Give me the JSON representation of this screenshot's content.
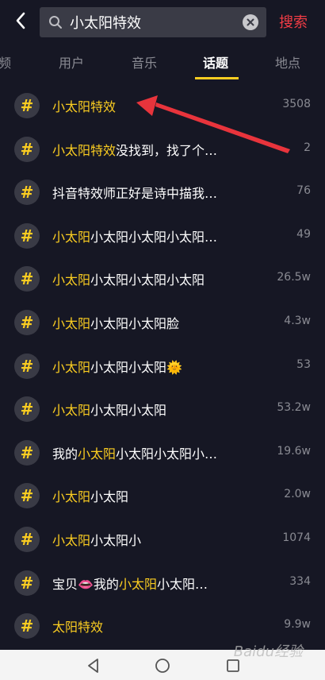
{
  "search": {
    "query": "小太阳特效",
    "submit_label": "搜索"
  },
  "tabs": [
    {
      "label": "频"
    },
    {
      "label": "用户"
    },
    {
      "label": "音乐"
    },
    {
      "label": "话题"
    },
    {
      "label": "地点"
    }
  ],
  "active_tab": "话题",
  "hash_symbol": "#",
  "topics": [
    {
      "segments": [
        {
          "text": "小太阳特效",
          "hl": true
        }
      ],
      "count": "3508"
    },
    {
      "segments": [
        {
          "text": "小太阳特效",
          "hl": true
        },
        {
          "text": "没找到，找了个…",
          "hl": false
        }
      ],
      "count": "2"
    },
    {
      "segments": [
        {
          "text": "抖音特效师正好是诗中描我…",
          "hl": false
        }
      ],
      "count": "76"
    },
    {
      "segments": [
        {
          "text": "小太阳",
          "hl": true
        },
        {
          "text": "小太阳小太阳小太阳…",
          "hl": false
        }
      ],
      "count": "49"
    },
    {
      "segments": [
        {
          "text": "小太阳",
          "hl": true
        },
        {
          "text": "小太阳小太阳小太阳",
          "hl": false
        }
      ],
      "count": "26.5w"
    },
    {
      "segments": [
        {
          "text": "小太阳",
          "hl": true
        },
        {
          "text": "小太阳小太阳脸",
          "hl": false
        }
      ],
      "count": "4.3w"
    },
    {
      "segments": [
        {
          "text": "小太阳",
          "hl": true
        },
        {
          "text": "小太阳小太阳🌞",
          "hl": false
        }
      ],
      "count": "53"
    },
    {
      "segments": [
        {
          "text": "小太阳",
          "hl": true
        },
        {
          "text": "小太阳小太阳",
          "hl": false
        }
      ],
      "count": "53.2w"
    },
    {
      "segments": [
        {
          "text": "我的",
          "hl": false
        },
        {
          "text": "小太阳",
          "hl": true
        },
        {
          "text": "小太阳小太阳小…",
          "hl": false
        }
      ],
      "count": "19.6w"
    },
    {
      "segments": [
        {
          "text": "小太阳",
          "hl": true
        },
        {
          "text": "小太阳",
          "hl": false
        }
      ],
      "count": "2.0w"
    },
    {
      "segments": [
        {
          "text": "小太阳",
          "hl": true
        },
        {
          "text": "小太阳小",
          "hl": false
        }
      ],
      "count": "1074"
    },
    {
      "segments": [
        {
          "text": "宝贝👄我的",
          "hl": false
        },
        {
          "text": "小太阳",
          "hl": true
        },
        {
          "text": "小太阳…",
          "hl": false
        }
      ],
      "count": "334"
    },
    {
      "segments": [
        {
          "text": "太阳特效",
          "hl": true
        }
      ],
      "count": "9.9w"
    }
  ],
  "watermark": "Baidu经验",
  "colors": {
    "highlight": "#fbcd21",
    "search_submit": "#f23c45",
    "annotation_arrow": "#e8343c",
    "background": "#161724"
  },
  "icons": {
    "back": "chevron-left-icon",
    "search": "search-icon",
    "clear": "clear-icon",
    "hash": "hash-icon"
  }
}
